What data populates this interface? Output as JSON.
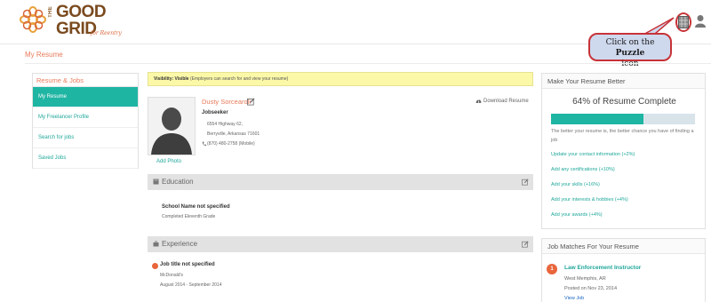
{
  "brand": {
    "the": "THE",
    "good": "GOOD",
    "grid": "GRID",
    "tagline": "for Reentry"
  },
  "callout": {
    "prefix": "Click on the ",
    "emphasis": "Puzzle",
    "suffix": "icon"
  },
  "page_title": "My Resume",
  "sidebar": {
    "heading": "Resume & Jobs",
    "items": [
      {
        "label": "My Resume",
        "active": true
      },
      {
        "label": "My Freelancer Profile",
        "active": false
      },
      {
        "label": "Search for jobs",
        "active": false
      },
      {
        "label": "Saved Jobs",
        "active": false
      }
    ]
  },
  "visibility": {
    "label": "Visibility: Visible",
    "note": " (Employers can search for and view your resume)"
  },
  "profile": {
    "name": "Dusty Sorcearoli",
    "role": "Jobseeker",
    "address_line1": "6554 Highway 62,",
    "address_line2": "Berryville, Arkansas 71601",
    "phone": "(870) 480-2758 (Mobile)",
    "add_photo": "Add Photo"
  },
  "download_label": "Download Resume",
  "education": {
    "heading": "Education",
    "school": "School Name not specified",
    "grade": "Completed Eleventh Grade"
  },
  "experience": {
    "heading": "Experience",
    "title": "Job title not specified",
    "company": "McDonald's",
    "dates": "August 2014 - September 2014"
  },
  "resume_better": {
    "heading": "Make Your Resume Better",
    "percent_label": "64% of Resume Complete",
    "percent_value": 64,
    "advice": "The better your resume is, the better chance you have of finding a job",
    "tips": [
      "Update your contact information (+2%)",
      "Add any certifications (+10%)",
      "Add your skills (+16%)",
      "Add your interests & hobbies (+4%)",
      "Add your awards (+4%)"
    ]
  },
  "job_matches": {
    "heading": "Job Matches For Your Resume",
    "number": "1",
    "title": "Law Enforcement Instructor",
    "location": "West Memphis, AR",
    "posted": "Posted on Nov 23, 2014",
    "view": "View Job"
  },
  "colors": {
    "accent_teal": "#1fb5a3",
    "accent_orange": "#e97a5a",
    "callout_border": "#c73338",
    "visibility_bg": "#fbf8a8"
  }
}
